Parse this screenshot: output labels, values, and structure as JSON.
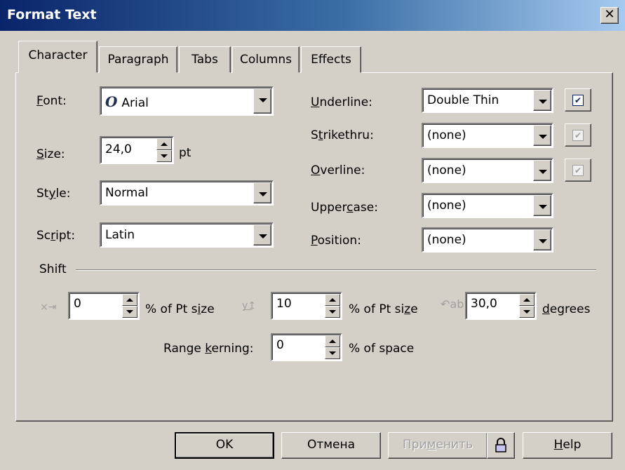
{
  "window": {
    "title": "Format Text",
    "close_glyph": "✕"
  },
  "tabs": [
    {
      "label": "Character",
      "active": true
    },
    {
      "label": "Paragraph",
      "active": false
    },
    {
      "label": "Tabs",
      "active": false
    },
    {
      "label": "Columns",
      "active": false
    },
    {
      "label": "Effects",
      "active": false
    }
  ],
  "font": {
    "label_mn": "F",
    "label_rest": "ont:",
    "value": "Arial",
    "icon": "opentype-font-icon",
    "icon_glyph": "O"
  },
  "size": {
    "label_mn": "S",
    "label_rest": "ize:",
    "value": "24,0",
    "unit": "pt"
  },
  "style": {
    "label_pre": "St",
    "label_mn": "y",
    "label_rest": "le:",
    "value": "Normal"
  },
  "script": {
    "label_pre": "Sc",
    "label_mn": "r",
    "label_rest": "ipt:",
    "value": "Latin"
  },
  "underline": {
    "label_mn": "U",
    "label_rest": "nderline:",
    "value": "Double Thin",
    "checked": true
  },
  "strikethru": {
    "label_pre": "S",
    "label_mn": "t",
    "label_rest": "rikethru:",
    "value": "(none)",
    "checked": true
  },
  "overline": {
    "label_mn": "O",
    "label_rest": "verline:",
    "value": "(none)",
    "checked": true
  },
  "uppercase": {
    "label_pre": "Upper",
    "label_mn": "c",
    "label_rest": "ase:",
    "value": "(none)"
  },
  "position": {
    "label_mn": "P",
    "label_rest": "osition:",
    "value": "(none)"
  },
  "shift": {
    "label": "Shift",
    "horizontal": {
      "value": "0",
      "unit_pre": "% of Pt s",
      "unit_mn": "i",
      "unit_rest": "ze"
    },
    "vertical": {
      "value": "10",
      "unit_pre": "% of Pt si",
      "unit_mn": "z",
      "unit_rest": "e"
    },
    "rotation": {
      "value": "30,0",
      "unit_mn": "d",
      "unit_rest": "egrees"
    }
  },
  "kerning": {
    "label_pre": "Range ",
    "label_mn": "k",
    "label_rest": "erning:",
    "value": "0",
    "unit": "% of space"
  },
  "buttons": {
    "ok": "OK",
    "cancel": "Отмена",
    "apply_pre": "При",
    "apply_mn": "м",
    "apply_rest": "енить",
    "help_mn": "H",
    "help_rest": "elp"
  }
}
